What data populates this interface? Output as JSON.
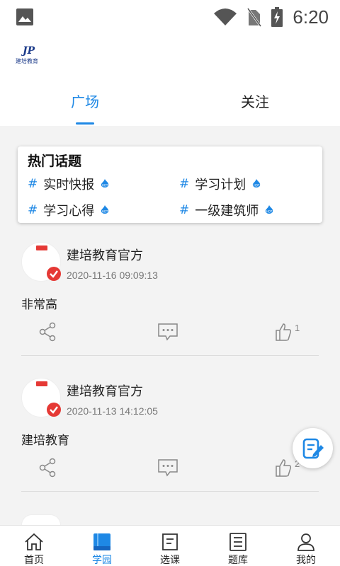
{
  "status_bar": {
    "time": "6:20"
  },
  "logo": {
    "text": "建培教育"
  },
  "tabs": [
    {
      "label": "广场",
      "active": true
    },
    {
      "label": "关注",
      "active": false
    }
  ],
  "hot_topics": {
    "title": "热门话题",
    "items": [
      {
        "hash": "#",
        "label": "实时快报"
      },
      {
        "hash": "#",
        "label": "学习计划"
      },
      {
        "hash": "#",
        "label": "学习心得"
      },
      {
        "hash": "#",
        "label": "一级建筑师"
      }
    ]
  },
  "posts": [
    {
      "author": "建培教育官方",
      "date": "2020-11-16 09:09:13",
      "content": "非常高",
      "likes": "1"
    },
    {
      "author": "建培教育官方",
      "date": "2020-11-13 14:12:05",
      "content": "建培教育",
      "likes": "2"
    }
  ],
  "bottom_nav": [
    {
      "label": "首页",
      "icon": "home-icon"
    },
    {
      "label": "学园",
      "icon": "book-icon",
      "active": true
    },
    {
      "label": "选课",
      "icon": "course-icon"
    },
    {
      "label": "题库",
      "icon": "list-icon"
    },
    {
      "label": "我的",
      "icon": "user-icon"
    }
  ],
  "colors": {
    "accent": "#1e88e5",
    "verified": "#e53935"
  }
}
